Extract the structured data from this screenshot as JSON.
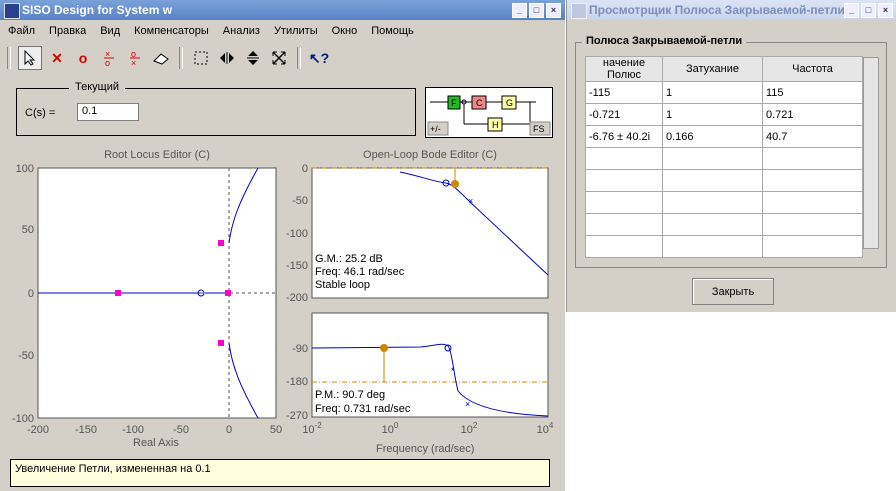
{
  "main_window": {
    "title": "SISO Design for System w",
    "menu": [
      "Файл",
      "Правка",
      "Вид",
      "Компенсаторы",
      "Анализ",
      "Утилиты",
      "Окно",
      "Помощь"
    ]
  },
  "toolbar_icons": [
    "select-arrow-icon",
    "add-pole-icon",
    "add-zero-icon",
    "add-lead-icon",
    "add-lag-icon",
    "eraser-icon",
    "zoom-box-icon",
    "zoom-x-icon",
    "zoom-y-icon",
    "fit-icon",
    "whats-this-icon"
  ],
  "compensator": {
    "title": "Текущий",
    "label": "C(s) =",
    "value": "0.1"
  },
  "diagram": {
    "blocks": [
      "F",
      "C",
      "G",
      "H"
    ],
    "sign_button": "+/-",
    "fs_button": "FS"
  },
  "root_locus": {
    "title": "Root Locus Editor (C)",
    "xlabel": "Real Axis",
    "xticks": [
      "-200",
      "-150",
      "-100",
      "-50",
      "0",
      "50"
    ],
    "yticks": [
      "100",
      "50",
      "0",
      "-50",
      "-100"
    ]
  },
  "bode_mag": {
    "title": "Open-Loop Bode Editor (C)",
    "yticks": [
      "0",
      "-50",
      "-100",
      "-150",
      "-200"
    ],
    "gm": "G.M.: 25.2 dB",
    "freq": "Freq: 46.1 rad/sec",
    "stable": "Stable loop"
  },
  "bode_phase": {
    "yticks": [
      "-90",
      "-180",
      "-270"
    ],
    "pm": "P.M.: 90.7 deg",
    "freq": "Freq: 0.731 rad/sec",
    "xlabel": "Frequency (rad/sec)",
    "xticks": [
      {
        "b": "10",
        "e": "-2"
      },
      {
        "b": "10",
        "e": "0"
      },
      {
        "b": "10",
        "e": "2"
      },
      {
        "b": "10",
        "e": "4"
      }
    ]
  },
  "status": "Увеличение Петли, измененная на 0.1",
  "poles_window": {
    "title": "Просмотрщик Полюса Закрываемой-петли",
    "panel_title": "Полюса Закрываемой-петли",
    "columns": [
      "начение Полюс",
      "Затухание",
      "Частота"
    ],
    "rows": [
      [
        "-115",
        "1",
        "115"
      ],
      [
        "-0.721",
        "1",
        "0.721"
      ],
      [
        "-6.76 ± 40.2i",
        "0.166",
        "40.7"
      ]
    ],
    "close_label": "Закрыть"
  },
  "colors": {
    "accent_line": "#0000cc",
    "marker": "#ff00cc",
    "margin": "#cc8800",
    "grid": "#555555"
  }
}
